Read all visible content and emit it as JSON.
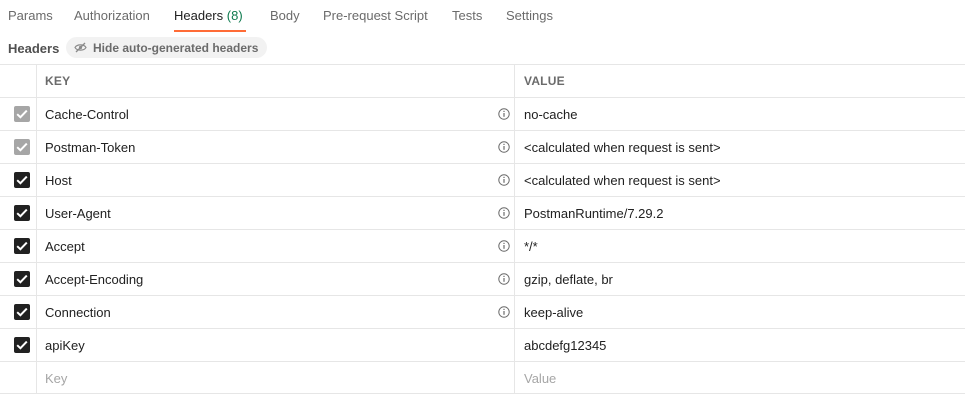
{
  "tabs": [
    {
      "label": "Params"
    },
    {
      "label": "Authorization"
    },
    {
      "label": "Headers",
      "count": "(8)",
      "active": true
    },
    {
      "label": "Body"
    },
    {
      "label": "Pre-request Script"
    },
    {
      "label": "Tests"
    },
    {
      "label": "Settings"
    }
  ],
  "subbar": {
    "title": "Headers",
    "hide_button_label": "Hide auto-generated headers"
  },
  "table": {
    "columns": {
      "key": "KEY",
      "value": "VALUE"
    },
    "rows": [
      {
        "key": "Cache-Control",
        "value": "no-cache",
        "checked": true,
        "auto_generated": true,
        "info_icon": true
      },
      {
        "key": "Postman-Token",
        "value": "<calculated when request is sent>",
        "checked": true,
        "auto_generated": true,
        "info_icon": true
      },
      {
        "key": "Host",
        "value": "<calculated when request is sent>",
        "checked": true,
        "auto_generated": false,
        "info_icon": true
      },
      {
        "key": "User-Agent",
        "value": "PostmanRuntime/7.29.2",
        "checked": true,
        "auto_generated": false,
        "info_icon": true
      },
      {
        "key": "Accept",
        "value": "*/*",
        "checked": true,
        "auto_generated": false,
        "info_icon": true
      },
      {
        "key": "Accept-Encoding",
        "value": "gzip, deflate, br",
        "checked": true,
        "auto_generated": false,
        "info_icon": true
      },
      {
        "key": "Connection",
        "value": "keep-alive",
        "checked": true,
        "auto_generated": false,
        "info_icon": true
      },
      {
        "key": "apiKey",
        "value": "abcdefg12345",
        "checked": true,
        "auto_generated": false,
        "info_icon": false
      }
    ],
    "new_row": {
      "key_placeholder": "Key",
      "value_placeholder": "Value"
    }
  },
  "colors": {
    "accent": "#ff6c37",
    "count": "#0f7b4f",
    "checkbox_on": "#212121",
    "checkbox_auto": "#a6a6a6"
  }
}
